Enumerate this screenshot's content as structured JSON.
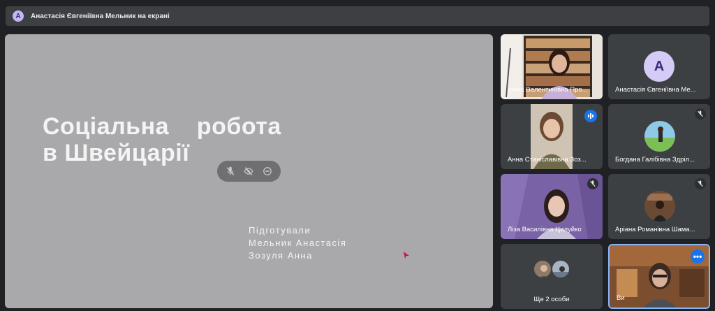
{
  "presenter_banner": {
    "avatar_letter": "А",
    "text": "Анастасія Євгеніївна Мельник на екрані"
  },
  "slide": {
    "title_line1": "Соціальна    робота",
    "title_line2": "в Швейцарії",
    "sub_line1": "Підготували",
    "sub_line2": "Мельник Анастасія",
    "sub_line3": "Зозуля Анна",
    "controls": [
      "mic-off-icon",
      "visibility-off-icon",
      "remove-circle-icon"
    ]
  },
  "participants": [
    {
      "name": "Ірина Валентинівна Про...",
      "type": "video",
      "muted": false
    },
    {
      "name": "Анастасія Євгеніївна Ме...",
      "type": "avatar",
      "letter": "А",
      "muted": false
    },
    {
      "name": "Анна Станіславівна Зоз...",
      "type": "video",
      "speaking": true
    },
    {
      "name": "Богдана Галібівна Здріл...",
      "type": "photo",
      "muted": true
    },
    {
      "name": "Ліза Василівна Цилуйко",
      "type": "video",
      "muted": true
    },
    {
      "name": "Аріана Романівна Шама...",
      "type": "photo",
      "muted": true
    },
    {
      "name": "Ще 2 особи",
      "type": "group"
    },
    {
      "name": "Ви",
      "type": "video",
      "self": true
    }
  ],
  "colors": {
    "background": "#202124",
    "tile": "#3c4043",
    "slide": "#a9a8ab",
    "accent": "#1a73e8",
    "self_border": "#8ab4f8"
  }
}
